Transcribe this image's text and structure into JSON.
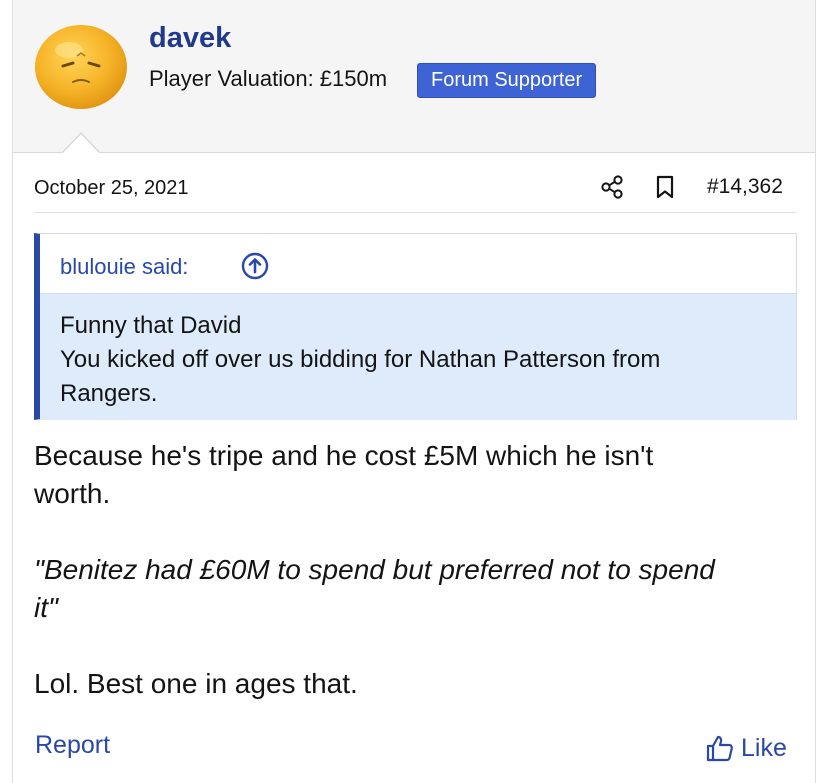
{
  "user": {
    "name": "davek",
    "title": "Player Valuation: £150m",
    "badge": "Forum Supporter",
    "avatar_icon": "orange-face-avatar"
  },
  "post": {
    "date": "October 25, 2021",
    "number": "#14,362",
    "share_icon": "share-icon",
    "bookmark_icon": "bookmark-icon"
  },
  "quote": {
    "author": "blulouie said:",
    "arrow_icon": "arrow-up-circle-icon",
    "lines": [
      "Funny that David",
      "You kicked off over us bidding for Nathan Patterson from",
      "Rangers."
    ]
  },
  "message": {
    "line1": "Because he's tripe and he cost £5M which he isn't",
    "line2": "worth.",
    "quote_line1": "\"Benitez had £60M to spend but preferred not to spend",
    "quote_line2": "it\"",
    "closing": "Lol. Best one in ages that."
  },
  "actions": {
    "report": "Report",
    "like": "Like",
    "like_icon": "thumbs-up-icon"
  },
  "colors": {
    "accent": "#2a48a6",
    "badge": "#3d63d4",
    "quote_bg": "#deebfa",
    "header_bg": "#f5f5f5"
  }
}
